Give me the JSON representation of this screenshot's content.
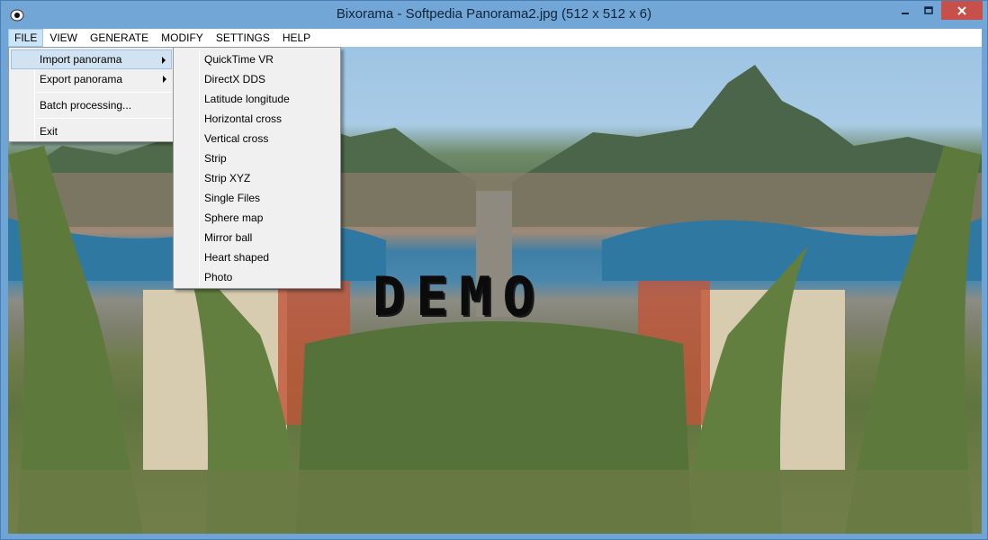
{
  "window": {
    "title": "Bixorama - Softpedia Panorama2.jpg (512 x 512 x 6)"
  },
  "menubar": {
    "items": [
      "FILE",
      "VIEW",
      "GENERATE",
      "MODIFY",
      "SETTINGS",
      "HELP"
    ]
  },
  "file_menu": {
    "items": [
      "Import panorama",
      "Export panorama",
      "Batch processing...",
      "Exit"
    ]
  },
  "import_submenu": {
    "items": [
      "QuickTime VR",
      "DirectX DDS",
      "Latitude longitude",
      "Horizontal cross",
      "Vertical cross",
      "Strip",
      "Strip XYZ",
      "Single Files",
      "Sphere map",
      "Mirror ball",
      "Heart shaped",
      "Photo"
    ]
  },
  "canvas": {
    "watermark": "DEMO"
  },
  "colors": {
    "titlebar": "#72a6d7",
    "close_button": "#c7504a",
    "menu_highlight": "#cce4f7"
  }
}
